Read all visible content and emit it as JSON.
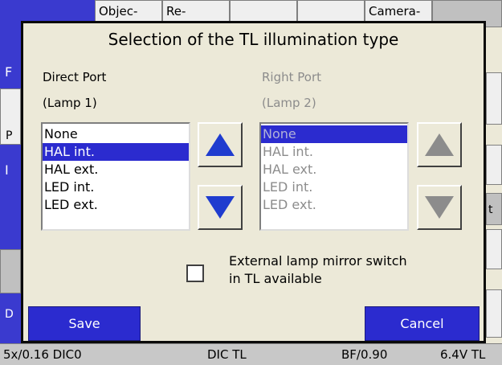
{
  "background": {
    "tabs": [
      "Objec-",
      "Re-",
      "",
      "",
      "Camera-"
    ],
    "side_letters": [
      "F",
      "P",
      "I",
      "D"
    ],
    "right_letters": [
      "t"
    ]
  },
  "status_bar": {
    "objective": "5x/0.16 DIC0",
    "contrast": "DIC TL",
    "condenser": "BF/0.90",
    "voltage": "6.4V TL"
  },
  "dialog": {
    "title": "Selection of the TL illumination type",
    "direct_port": {
      "label": "Direct Port",
      "lamp": "(Lamp 1)",
      "options": [
        "None",
        "HAL int.",
        "HAL ext.",
        "LED int.",
        "LED ext."
      ],
      "selected": "HAL int."
    },
    "right_port": {
      "label": "Right Port",
      "lamp": "(Lamp 2)",
      "options": [
        "None",
        "HAL int.",
        "HAL ext.",
        "LED int.",
        "LED ext."
      ],
      "selected": "None"
    },
    "checkbox": {
      "label_line1": "External lamp mirror switch",
      "label_line2": "in TL available",
      "checked": false
    },
    "save_label": "Save",
    "cancel_label": "Cancel"
  },
  "colors": {
    "accent_blue": "#2b2bcf",
    "dialog_bg": "#ece9d8",
    "disabled_text": "#8c8c8c"
  }
}
